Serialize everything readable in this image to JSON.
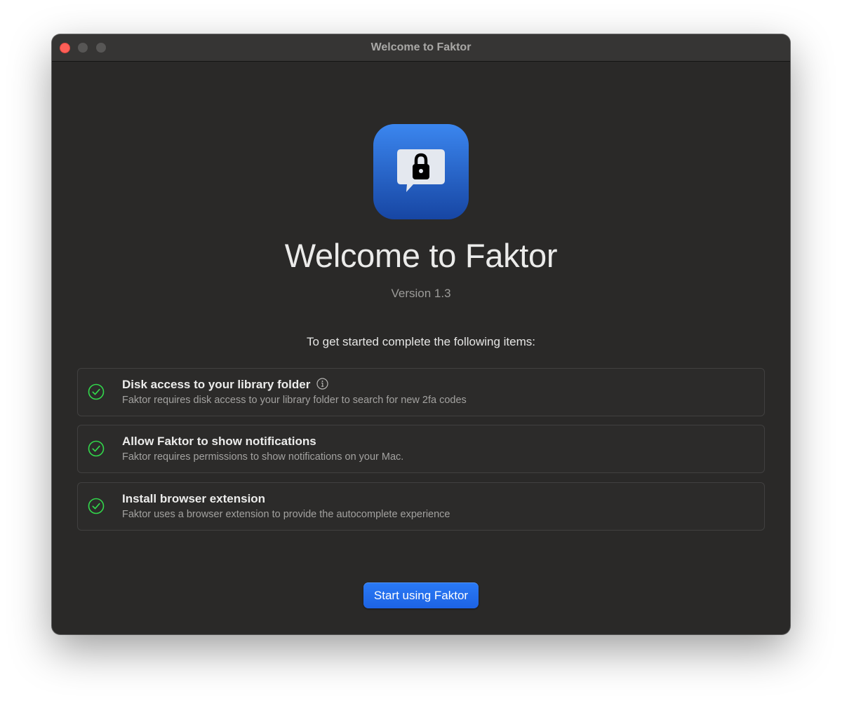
{
  "window": {
    "title": "Welcome to Faktor"
  },
  "app": {
    "icon": "lock-message-icon",
    "accent_color": "#1f66e0"
  },
  "welcome": {
    "title": "Welcome to Faktor",
    "version": "Version 1.3",
    "intro": "To get started complete the following items:"
  },
  "checklist": {
    "status_color": "#32d74b",
    "items": [
      {
        "title": "Disk access to your library folder",
        "description": "Faktor requires disk access to your library folder to search for new 2fa codes",
        "completed": true,
        "has_info": true
      },
      {
        "title": "Allow Faktor to show notifications",
        "description": "Faktor requires permissions to show notifications on your Mac.",
        "completed": true,
        "has_info": false
      },
      {
        "title": "Install browser extension",
        "description": "Faktor uses a browser extension to provide the autocomplete experience",
        "completed": true,
        "has_info": false
      }
    ]
  },
  "actions": {
    "start_label": "Start using Faktor"
  }
}
